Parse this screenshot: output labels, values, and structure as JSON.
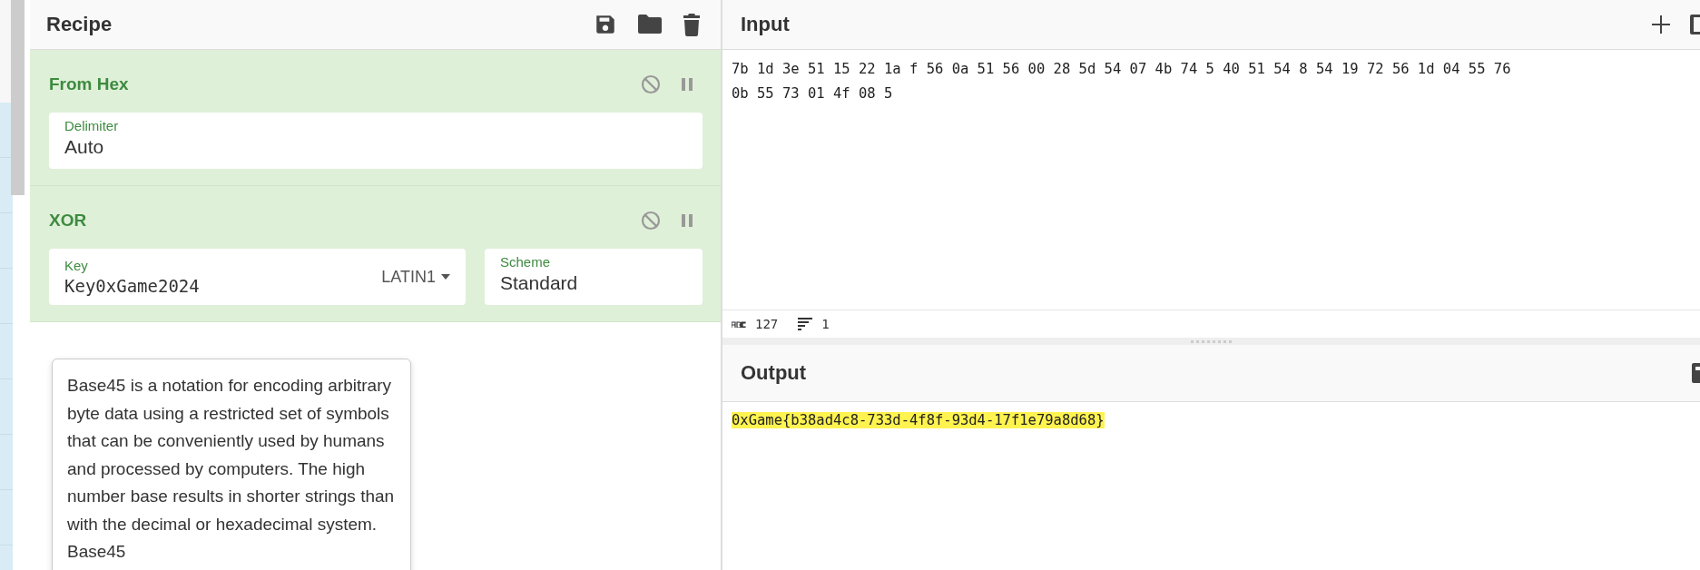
{
  "recipe": {
    "title": "Recipe",
    "operations": [
      {
        "name": "From Hex",
        "fields": [
          {
            "kind": "text",
            "label": "Delimiter",
            "value": "Auto"
          }
        ]
      },
      {
        "name": "XOR",
        "fields": [
          {
            "kind": "keyed",
            "label": "Key",
            "value": "Key0xGame2024",
            "option": "LATIN1"
          },
          {
            "kind": "text",
            "label": "Scheme",
            "value": "Standard"
          }
        ]
      }
    ]
  },
  "tooltip": {
    "text": "Base45 is a notation for encoding arbitrary byte data using a restricted set of symbols that can be conveniently used by humans and processed by computers. The high number base results in shorter strings than with the decimal or hexadecimal system. Base45"
  },
  "input": {
    "title": "Input",
    "value": "7b 1d 3e 51 15 22 1a f 56 0a 51 56 00 28 5d 54 07 4b 74 5 40 51 54 8 54 19 72 56 1d 04 55 76\n0b 55 73 01 4f 08 5",
    "length": "127",
    "lines": "1"
  },
  "output": {
    "title": "Output",
    "value": "0xGame{b38ad4c8-733d-4f8f-93d4-17f1e79a8d68}",
    "highlighted": true
  }
}
